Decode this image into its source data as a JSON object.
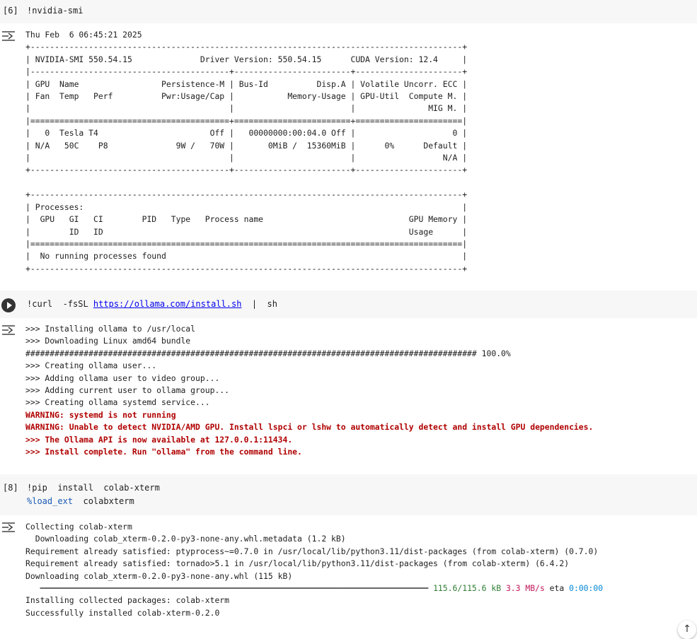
{
  "cells": [
    {
      "exec_count": "[6]",
      "code": [
        "!nvidia-smi"
      ],
      "output": [
        "Thu Feb  6 06:45:21 2025",
        "+-----------------------------------------------------------------------------------------+",
        "| NVIDIA-SMI 550.54.15              Driver Version: 550.54.15      CUDA Version: 12.4     |",
        "|-----------------------------------------+------------------------+----------------------+",
        "| GPU  Name                 Persistence-M | Bus-Id          Disp.A | Volatile Uncorr. ECC |",
        "| Fan  Temp   Perf          Pwr:Usage/Cap |           Memory-Usage | GPU-Util  Compute M. |",
        "|                                         |                        |               MIG M. |",
        "|=========================================+========================+======================|",
        "|   0  Tesla T4                       Off |   00000000:00:04.0 Off |                    0 |",
        "| N/A   50C    P8              9W /   70W |       0MiB /  15360MiB |      0%      Default |",
        "|                                         |                        |                  N/A |",
        "+-----------------------------------------+------------------------+----------------------+",
        "",
        "+-----------------------------------------------------------------------------------------+",
        "| Processes:                                                                              |",
        "|  GPU   GI   CI        PID   Type   Process name                              GPU Memory |",
        "|        ID   ID                                                               Usage      |",
        "|=========================================================================================|",
        "|  No running processes found                                                             |",
        "+-----------------------------------------------------------------------------------------+"
      ]
    },
    {
      "exec_count": "",
      "code_cmd": "!curl  -fsSL ",
      "code_url": "https://ollama.com/install.sh",
      "code_rest": "  |  sh",
      "output_plain": [
        ">>> Installing ollama to /usr/local",
        ">>> Downloading Linux amd64 bundle",
        "############################################################################################# 100.0%",
        ">>> Creating ollama user...",
        ">>> Adding ollama user to video group...",
        ">>> Adding current user to ollama group...",
        ">>> Creating ollama systemd service..."
      ],
      "output_warn": [
        "WARNING: systemd is not running",
        "WARNING: Unable to detect NVIDIA/AMD GPU. Install lspci or lshw to automatically detect and install GPU dependencies.",
        ">>> The Ollama API is now available at 127.0.0.1:11434.",
        ">>> Install complete. Run \"ollama\" from the command line."
      ]
    },
    {
      "exec_count": "[8]",
      "code_line1": "!pip  install  colab-xterm",
      "code_line2_magic": "%load_ext",
      "code_line2_rest": "  colabxterm",
      "output_lines": [
        "Collecting colab-xterm",
        "  Downloading colab_xterm-0.2.0-py3-none-any.whl.metadata (1.2 kB)",
        "Requirement already satisfied: ptyprocess~=0.7.0 in /usr/local/lib/python3.11/dist-packages (from colab-xterm) (0.7.0)",
        "Requirement already satisfied: tornado>5.1 in /usr/local/lib/python3.11/dist-packages (from colab-xterm) (6.4.2)",
        "Downloading colab_xterm-0.2.0-py3-none-any.whl (115 kB)"
      ],
      "progress_bar": "   ━━━━━━━━━━━━━━━━━━━━━━━━━━━━━━━━━━━━━━━━━━━━━━━━━━━━━━━━━━━━━━━━━━━━━━━━━━━━━━━━ ",
      "progress_size": "115.6/115.6 kB",
      "progress_speed": "3.3 MB/s",
      "progress_eta_label": " eta ",
      "progress_eta": "0:00:00",
      "output_tail": [
        "Installing collected packages: colab-xterm",
        "Successfully installed colab-xterm-0.2.0"
      ]
    }
  ],
  "scroll_button_icon": "arrow-up-icon",
  "scroll_button_glyph": "↑"
}
